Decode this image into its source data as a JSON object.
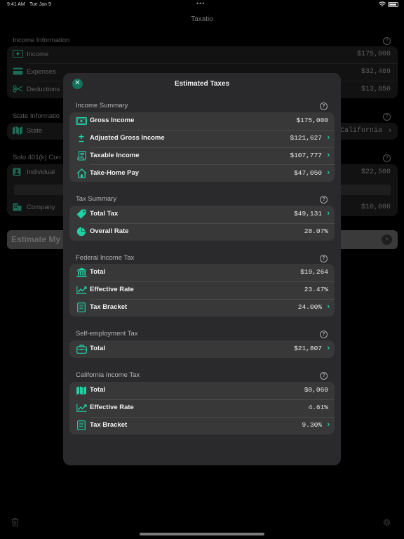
{
  "status_bar": {
    "time": "9:41 AM",
    "date": "Tue Jan 9",
    "dots": "•••"
  },
  "nav": {
    "title": "Taxatio"
  },
  "background": {
    "income_information": {
      "title": "Income Information",
      "rows": [
        {
          "label": "Income",
          "value": "$175,000",
          "icon": "banknote-icon"
        },
        {
          "label": "Expenses",
          "value": "$32,469",
          "icon": "credit-card-icon"
        },
        {
          "label": "Deductions",
          "value": "$13,850",
          "icon": "scissors-icon"
        }
      ]
    },
    "state_information": {
      "title": "State Informatio",
      "rows": [
        {
          "label": "State",
          "value": "California",
          "icon": "map-icon"
        }
      ]
    },
    "solo_401k": {
      "title": "Solo 401(k) Con",
      "rows": [
        {
          "label": "Individual",
          "value": "$22,500",
          "icon": "person-icon"
        },
        {
          "label": "Company",
          "value": "$10,000",
          "icon": "building-icon"
        }
      ]
    },
    "estimate_button": {
      "label": "Estimate My"
    }
  },
  "sheet": {
    "title": "Estimated Taxes",
    "sections": {
      "income_summary": {
        "title": "Income Summary",
        "rows": [
          {
            "label": "Gross Income",
            "value": "$175,000",
            "icon": "banknote-icon"
          },
          {
            "label": "Adjusted Gross Income",
            "value": "$121,627",
            "icon": "plus-minus-icon"
          },
          {
            "label": "Taxable Income",
            "value": "$107,777",
            "icon": "scroll-icon"
          },
          {
            "label": "Take-Home Pay",
            "value": "$47,050",
            "icon": "house-icon"
          }
        ]
      },
      "tax_summary": {
        "title": "Tax Summary",
        "rows": [
          {
            "label": "Total Tax",
            "value": "$49,131",
            "icon": "tag-icon"
          },
          {
            "label": "Overall Rate",
            "value": "28.07%",
            "icon": "pie-chart-icon"
          }
        ]
      },
      "federal_income_tax": {
        "title": "Federal Income Tax",
        "rows": [
          {
            "label": "Total",
            "value": "$19,264",
            "icon": "bank-building-icon"
          },
          {
            "label": "Effective Rate",
            "value": "23.47%",
            "icon": "trend-chart-icon"
          },
          {
            "label": "Tax Bracket",
            "value": "24.00%",
            "icon": "document-list-icon"
          }
        ]
      },
      "self_employment_tax": {
        "title": "Self-employment Tax",
        "rows": [
          {
            "label": "Total",
            "value": "$21,807",
            "icon": "briefcase-icon"
          }
        ]
      },
      "california_income_tax": {
        "title": "California Income Tax",
        "rows": [
          {
            "label": "Total",
            "value": "$8,060",
            "icon": "map-icon"
          },
          {
            "label": "Effective Rate",
            "value": "4.61%",
            "icon": "trend-chart-icon"
          },
          {
            "label": "Tax Bracket",
            "value": "9.30%",
            "icon": "document-list-icon"
          }
        ]
      }
    }
  },
  "colors": {
    "accent": "#1fd1a4",
    "sheet_bg": "#2a2a2c",
    "card_bg": "#383839",
    "close_button": "#13715c"
  }
}
